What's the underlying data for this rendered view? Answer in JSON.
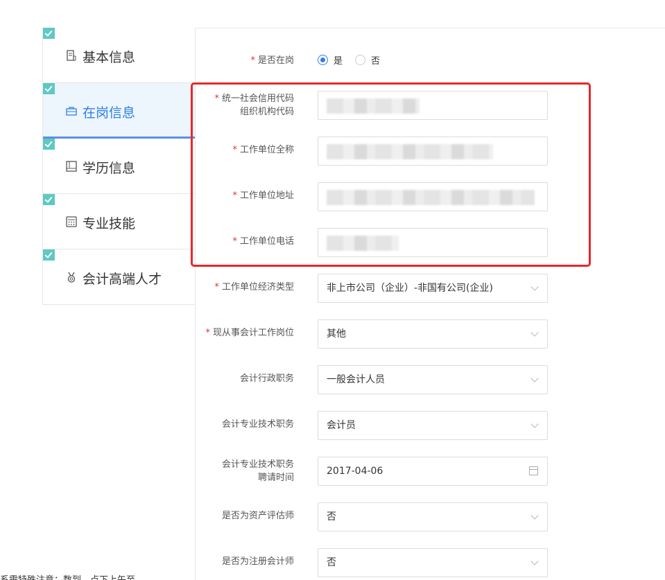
{
  "sidebar": {
    "items": [
      {
        "label": "基本信息"
      },
      {
        "label": "在岗信息"
      },
      {
        "label": "学历信息"
      },
      {
        "label": "专业技能"
      },
      {
        "label": "会计高端人才"
      }
    ]
  },
  "form": {
    "on_duty": {
      "label": "是否在岗",
      "yes": "是",
      "no": "否"
    },
    "credit_code": {
      "label_line1": "统一社会信用代码",
      "label_line2": "组织机构代码"
    },
    "unit_name": {
      "label": "工作单位全称"
    },
    "unit_address": {
      "label": "工作单位地址"
    },
    "unit_phone": {
      "label": "工作单位电话"
    },
    "unit_econ_type": {
      "label": "工作单位经济类型",
      "value": "非上市公司（企业）-非国有公司(企业)"
    },
    "current_post": {
      "label": "现从事会计工作岗位",
      "value": "其他"
    },
    "admin_duty": {
      "label": "会计行政职务",
      "value": "一般会计人员"
    },
    "tech_duty": {
      "label": "会计专业技术职务",
      "value": "会计员"
    },
    "tech_hire_date": {
      "label_line1": "会计专业技术职务",
      "label_line2": "聘请时间",
      "value": "2017-04-06"
    },
    "asset_appraiser": {
      "label": "是否为资产评估师",
      "value": "否"
    },
    "cpa": {
      "label": "是否为注册会计师",
      "value": "否"
    }
  },
  "required_mark": "*",
  "bottom_note": "系需特殊注意：数到…点下上午至…"
}
